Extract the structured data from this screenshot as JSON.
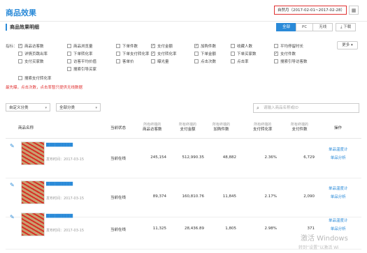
{
  "header": {
    "title": "商品效果",
    "date_range": "自然月（2017-02-01~2017-02-28）"
  },
  "section": {
    "title": "商品效果明细",
    "tabs": [
      "全部",
      "PC",
      "无线"
    ],
    "download": "下载"
  },
  "filters": {
    "label": "指标：",
    "more": "更多",
    "options": [
      {
        "label": "商品访客数",
        "checked": true
      },
      {
        "label": "商品浏览量",
        "checked": false
      },
      {
        "label": "下单件数",
        "checked": false
      },
      {
        "label": "支付金额",
        "checked": true
      },
      {
        "label": "加购件数",
        "checked": true
      },
      {
        "label": "收藏人数",
        "checked": false
      },
      {
        "label": "平均停留时长",
        "checked": false
      },
      {
        "label": "详情页跳出率",
        "checked": false
      },
      {
        "label": "下单转化率",
        "checked": false
      },
      {
        "label": "下单支付转化率",
        "checked": false
      },
      {
        "label": "支付转化率",
        "checked": true
      },
      {
        "label": "下单金额",
        "checked": false
      },
      {
        "label": "下单买家数",
        "checked": false
      },
      {
        "label": "支付件数",
        "checked": true
      },
      {
        "label": "支付买家数",
        "checked": false
      },
      {
        "label": "访客平均价值",
        "checked": false
      },
      {
        "label": "客单价",
        "checked": false
      },
      {
        "label": "曝光量",
        "checked": false
      },
      {
        "label": "点击次数",
        "checked": false
      },
      {
        "label": "点击率",
        "checked": false
      },
      {
        "label": "搜索引导访客数",
        "checked": false
      },
      {
        "label": "搜索引导买家",
        "checked": false
      },
      {
        "label": "搜索支付转化率",
        "checked": false
      }
    ],
    "note": "最先曝，点击次数，点击率暂只提供无线数据"
  },
  "selectors": {
    "left": "自定义分类",
    "right": "全部分类",
    "search_placeholder": "请输入商品名称或ID"
  },
  "table": {
    "headers": {
      "name": "商品名称",
      "status": "当前状态",
      "visitors": "商品访客数",
      "pay_amount": "支付金额",
      "cart": "加购件数",
      "conversion": "支付转化率",
      "pay_count": "支付件数",
      "ops": "操作",
      "subtitle": "所有终端的"
    },
    "rows": [
      {
        "name": "▇▇▇▇▇▇▇▇▇",
        "date": "发布时间：2017-03-15",
        "status": "当前在线",
        "visitors": "245,154",
        "pay_amount": "512,990.35",
        "cart": "48,882",
        "conversion": "2.36%",
        "pay_count": "6,729",
        "op1": "单品温度计",
        "op2": "单品分析"
      },
      {
        "name": "▇▇▇▇▇▇▇▇▇",
        "date": "发布时间：2017-03-15",
        "status": "当前在线",
        "visitors": "89,374",
        "pay_amount": "160,810.76",
        "cart": "11,845",
        "conversion": "2.17%",
        "pay_count": "2,090",
        "op1": "单品温度计",
        "op2": "单品分析"
      },
      {
        "name": "▇▇▇▇▇▇▇▇▇",
        "date": "发布时间：2017-03-15",
        "status": "当前在线",
        "visitors": "11,325",
        "pay_amount": "28,436.89",
        "cart": "1,805",
        "conversion": "2.98%",
        "pay_count": "371",
        "op1": "单品温度计",
        "op2": "单品分析"
      }
    ]
  },
  "watermark": {
    "line1": "激活 Windows",
    "line2": "转到“设置”以激活 Wi"
  }
}
